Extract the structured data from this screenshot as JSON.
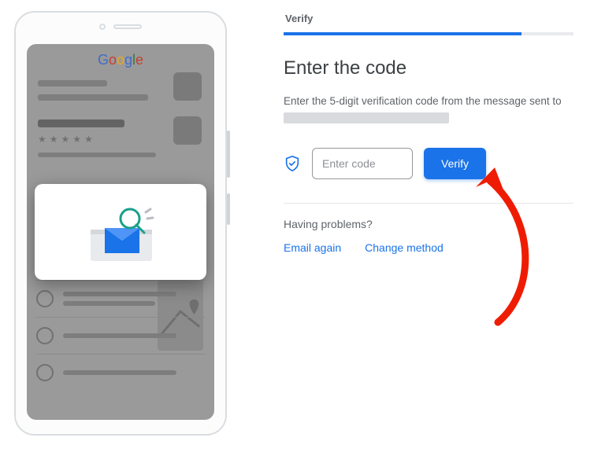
{
  "phone": {
    "brand_letters": [
      "G",
      "o",
      "o",
      "g",
      "l",
      "e"
    ]
  },
  "panel": {
    "tab_label": "Verify",
    "heading": "Enter the code",
    "instruction_prefix": "Enter the 5-digit verification code from the message sent to ",
    "shield_icon_name": "verified-shield-icon",
    "input_placeholder": "Enter code",
    "verify_button": "Verify",
    "problems_label": "Having problems?",
    "links": {
      "email_again": "Email again",
      "change_method": "Change method"
    }
  }
}
